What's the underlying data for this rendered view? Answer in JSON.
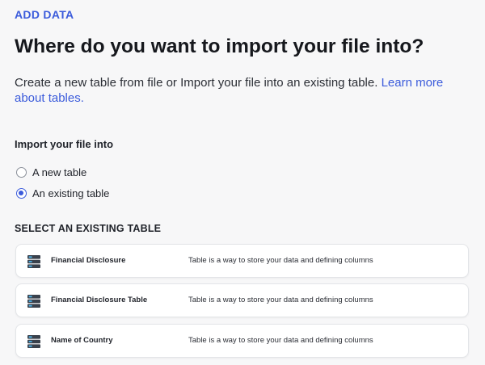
{
  "header": {
    "eyebrow": "ADD DATA",
    "title": "Where do you want to import your file into?",
    "description": "Create a new table from file or Import your file into an existing table.",
    "learn_more_link": "Learn more about tables."
  },
  "import_into": {
    "label": "Import your file into",
    "options": [
      {
        "label": "A new table",
        "selected": false
      },
      {
        "label": "An existing table",
        "selected": true
      }
    ]
  },
  "existing_tables": {
    "section_label": "SELECT AN EXISTING TABLE",
    "items": [
      {
        "name": "Financial Disclosure",
        "description": "Table is a way to store your data and defining columns",
        "icon": "database-icon"
      },
      {
        "name": "Financial Disclosure Table",
        "description": "Table is a way to store your data and defining columns",
        "icon": "database-icon"
      },
      {
        "name": "Name of Country",
        "description": "Table is a way to store your data and defining columns",
        "icon": "database-icon"
      }
    ]
  },
  "colors": {
    "accent": "#3b5bdb",
    "background": "#f7f7f8",
    "card": "#ffffff",
    "db_icon_dark": "#3a414c",
    "db_icon_light": "#4fb3e8"
  }
}
